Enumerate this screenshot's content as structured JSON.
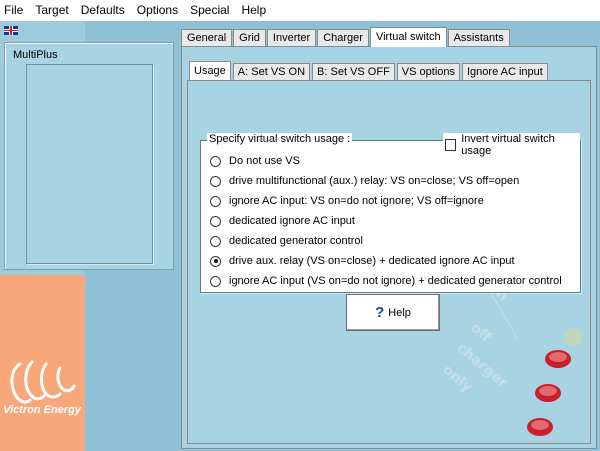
{
  "menu": [
    "File",
    "Target",
    "Defaults",
    "Options",
    "Special",
    "Help"
  ],
  "device": {
    "name": "MultiPlus"
  },
  "brand": {
    "name": "Victron Energy"
  },
  "tabs": [
    "General",
    "Grid",
    "Inverter",
    "Charger",
    "Virtual switch",
    "Assistants"
  ],
  "active_tab": "Virtual switch",
  "subtabs": [
    "Usage",
    "A:  Set VS ON",
    "B:  Set VS OFF",
    "VS options",
    "Ignore AC input"
  ],
  "active_subtab": "Usage",
  "group": {
    "title": "Specify virtual switch usage :",
    "invert_label": "Invert virtual switch usage",
    "invert_checked": false,
    "options": [
      {
        "label": "Do not use VS",
        "checked": false
      },
      {
        "label": "drive multifunctional (aux.) relay: VS on=close; VS off=open",
        "checked": false
      },
      {
        "label": "ignore AC input: VS on=do not ignore;  VS off=ignore",
        "checked": false
      },
      {
        "label": "dedicated ignore AC input",
        "checked": false
      },
      {
        "label": "dedicated generator control",
        "checked": false
      },
      {
        "label": "drive aux. relay (VS on=close) + dedicated ignore AC input",
        "checked": true
      },
      {
        "label": "ignore AC input (VS on=do not ignore) + dedicated generator control",
        "checked": false
      }
    ]
  },
  "help_button": {
    "icon": "question-icon",
    "label": "Help"
  },
  "background_text": [
    "on",
    "off",
    "charger",
    "only"
  ],
  "colors": {
    "panel": "#a8d3e2",
    "side_orange": "#f7a77a",
    "led_red": "#c8202a"
  }
}
